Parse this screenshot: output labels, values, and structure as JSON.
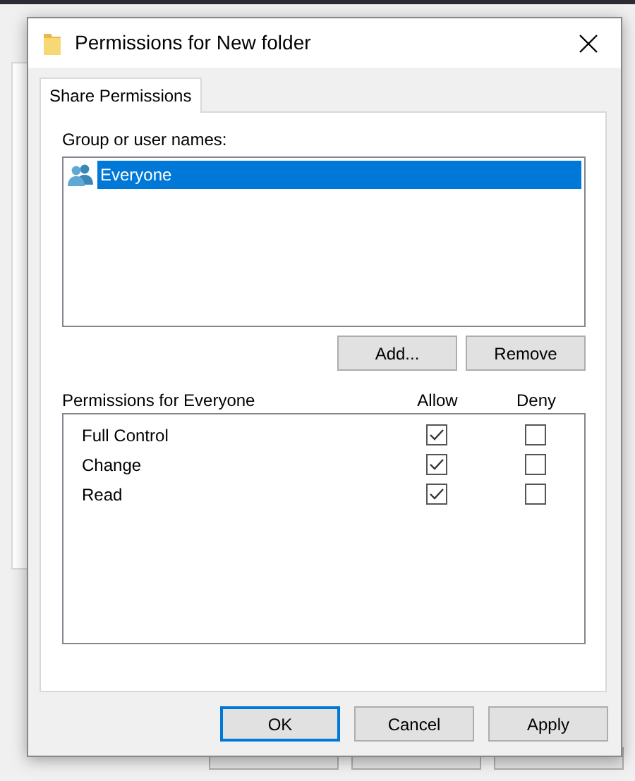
{
  "window": {
    "title": "Permissions for New folder"
  },
  "tabs": [
    {
      "label": "Share Permissions",
      "selected": true
    }
  ],
  "group_label": "Group or user names:",
  "users": [
    {
      "name": "Everyone",
      "selected": true
    }
  ],
  "user_buttons": [
    "Add...",
    "Remove"
  ],
  "permissions": {
    "label": "Permissions for Everyone",
    "columns": [
      "Allow",
      "Deny"
    ],
    "rows": [
      {
        "name": "Full Control",
        "allow": true,
        "deny": false
      },
      {
        "name": "Change",
        "allow": true,
        "deny": false
      },
      {
        "name": "Read",
        "allow": true,
        "deny": false
      }
    ]
  },
  "buttons": [
    {
      "label": "OK",
      "default": true
    },
    {
      "label": "Cancel",
      "default": false
    },
    {
      "label": "Apply",
      "default": false
    }
  ]
}
